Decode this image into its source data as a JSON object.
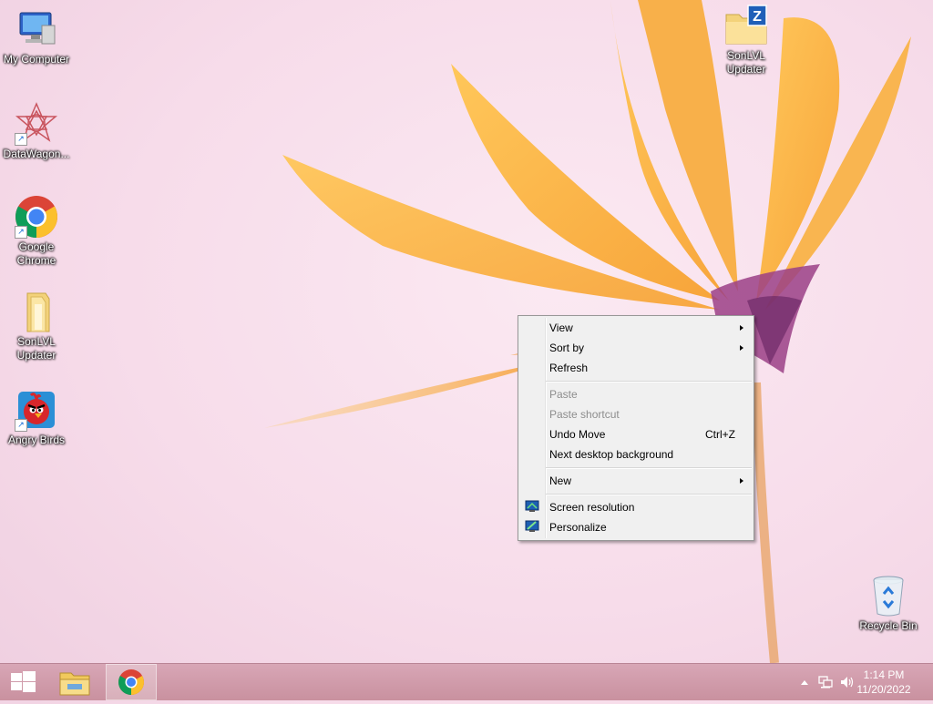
{
  "desktop": {
    "icons": [
      {
        "label": "My Computer"
      },
      {
        "label": "DataWagon..."
      },
      {
        "label": "Google Chrome"
      },
      {
        "label": "SonLVL Updater"
      },
      {
        "label": "Angry Birds"
      },
      {
        "label": "SonLVL Updater"
      },
      {
        "label": "Recycle Bin"
      }
    ]
  },
  "context_menu": {
    "view": "View",
    "sort_by": "Sort by",
    "refresh": "Refresh",
    "paste": "Paste",
    "paste_shortcut": "Paste shortcut",
    "undo_move": "Undo Move",
    "undo_move_key": "Ctrl+Z",
    "next_background": "Next desktop background",
    "new": "New",
    "screen_resolution": "Screen resolution",
    "personalize": "Personalize"
  },
  "taskbar": {
    "time": "1:14 PM",
    "date": "11/20/2022"
  },
  "colors": {
    "accent": "#1a6dd6",
    "menu_bg": "#f0f0f0",
    "taskbar": "#c9919f"
  }
}
